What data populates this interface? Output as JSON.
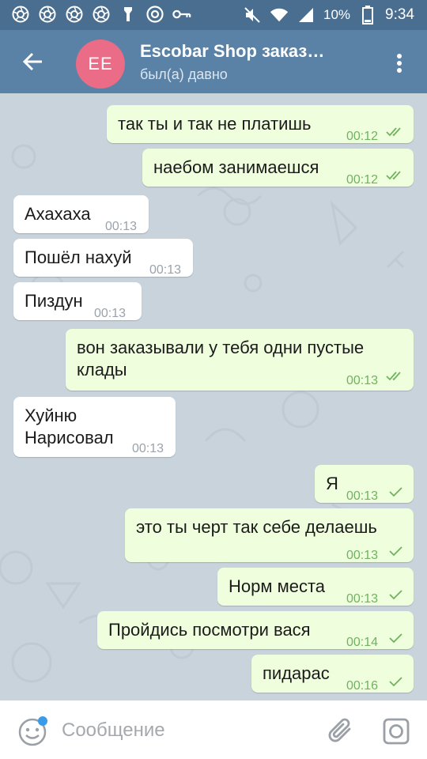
{
  "status_bar": {
    "battery_percent": "10%",
    "time": "9:34"
  },
  "header": {
    "avatar_initials": "EE",
    "title": "Escobar Shop заказ…",
    "status": "был(а) давно"
  },
  "messages": [
    {
      "direction": "out",
      "text": "так ты и так не платишь",
      "time": "00:12",
      "read": true
    },
    {
      "direction": "out",
      "text": "наебом занимаешся",
      "time": "00:12",
      "read": true
    },
    {
      "direction": "in",
      "text": "Ахахаха",
      "time": "00:13"
    },
    {
      "direction": "in",
      "text": "Пошёл нахуй",
      "time": "00:13"
    },
    {
      "direction": "in",
      "text": "Пиздун",
      "time": "00:13"
    },
    {
      "direction": "out",
      "text_line1": "вон заказывали у тебя одни пустые",
      "text_line2": "клады",
      "time": "00:13",
      "read": true
    },
    {
      "direction": "in",
      "text_line1": "Хуйню",
      "text_line2": "Нарисовал",
      "time": "00:13"
    },
    {
      "direction": "out",
      "text": "Я",
      "time": "00:13",
      "read": false
    },
    {
      "direction": "out",
      "text": "это ты черт так себе делаешь",
      "time": "00:13",
      "read": false
    },
    {
      "direction": "out",
      "text": "Норм места",
      "time": "00:13",
      "read": false
    },
    {
      "direction": "out",
      "text": "Пройдись посмотри вася",
      "time": "00:14",
      "read": false
    },
    {
      "direction": "out",
      "text": "пидарас",
      "time": "00:16",
      "read": false
    }
  ],
  "composer": {
    "placeholder": "Сообщение"
  },
  "colors": {
    "status_bar": "#4a6e8f",
    "app_bar": "#5a82a6",
    "avatar": "#ea6c86",
    "outgoing_bubble": "#effedd",
    "incoming_bubble": "#ffffff",
    "outgoing_time": "#6fb35f",
    "chat_background": "#c9d3dc"
  },
  "icons": [
    "camera-icon",
    "chrome-icon",
    "key-icon",
    "mute-icon",
    "wifi-icon",
    "signal-icon",
    "battery-icon",
    "back-arrow-icon",
    "more-vert-icon",
    "emoji-icon",
    "paperclip-icon",
    "instagram-camera-icon"
  ]
}
